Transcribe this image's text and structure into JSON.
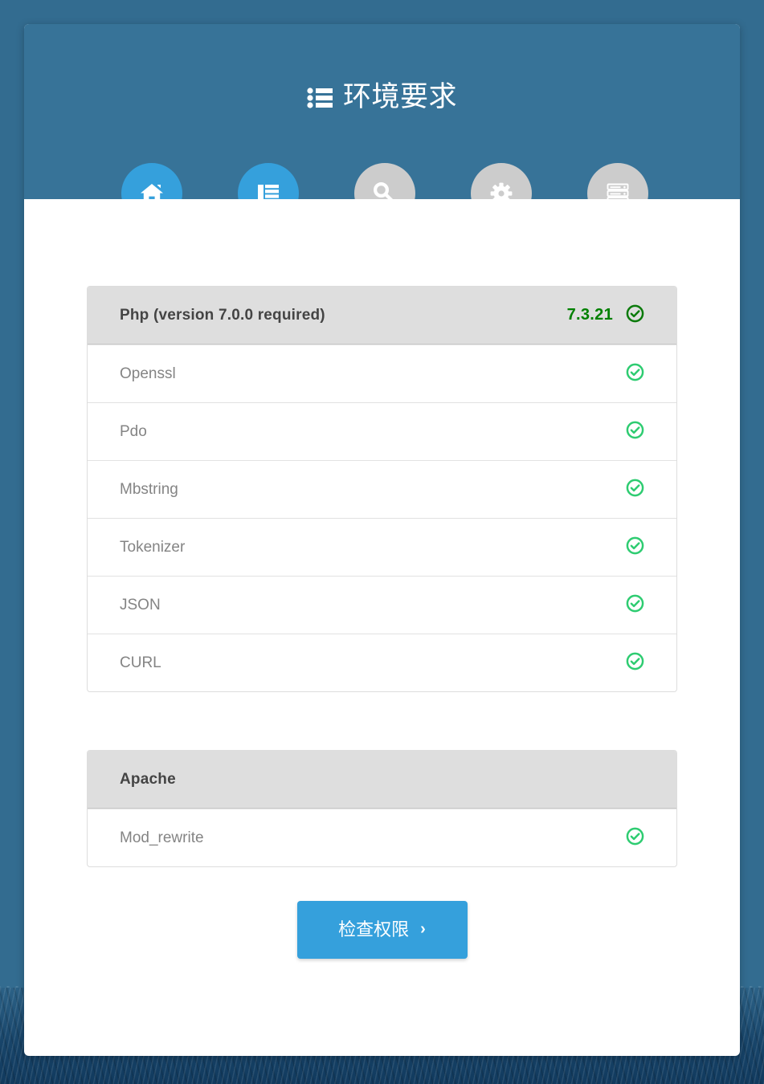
{
  "header": {
    "title": "环境要求",
    "title_icon": "list-icon",
    "background_color": "#377398"
  },
  "steps": [
    {
      "name": "home",
      "icon": "home-icon",
      "state": "active"
    },
    {
      "name": "requirements",
      "icon": "list-icon",
      "state": "active"
    },
    {
      "name": "permissions",
      "icon": "key-icon",
      "state": "inactive"
    },
    {
      "name": "configure",
      "icon": "gear-icon",
      "state": "inactive"
    },
    {
      "name": "database",
      "icon": "database-icon",
      "state": "inactive"
    }
  ],
  "panels": [
    {
      "id": "php",
      "title": "Php (version 7.0.0 required)",
      "version": "7.3.21",
      "status_icon": "check-circle-icon",
      "rows": [
        {
          "label": "Openssl",
          "status_icon": "check-circle-icon"
        },
        {
          "label": "Pdo",
          "status_icon": "check-circle-icon"
        },
        {
          "label": "Mbstring",
          "status_icon": "check-circle-icon"
        },
        {
          "label": "Tokenizer",
          "status_icon": "check-circle-icon"
        },
        {
          "label": "JSON",
          "status_icon": "check-circle-icon"
        },
        {
          "label": "CURL",
          "status_icon": "check-circle-icon"
        }
      ]
    },
    {
      "id": "apache",
      "title": "Apache",
      "version": "",
      "rows": [
        {
          "label": "Mod_rewrite",
          "status_icon": "check-circle-icon"
        }
      ]
    }
  ],
  "footer": {
    "next_label": "检查权限",
    "next_chevron": "›"
  },
  "colors": {
    "header_blue": "#377398",
    "accent_blue": "#35a0dc",
    "inactive_gray": "#cccccc",
    "panel_heading": "#dedede",
    "check_green": "#2ecc71",
    "version_green": "#008000",
    "row_text": "#848484"
  }
}
